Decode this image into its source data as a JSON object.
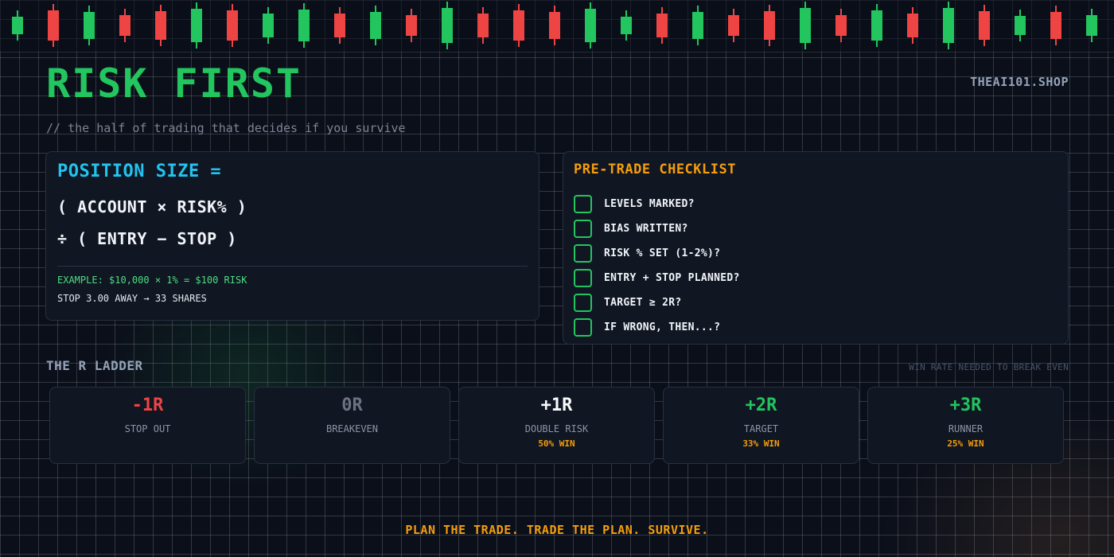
{
  "header": {
    "title": "RISK FIRST",
    "brand": "THEAI101.SHOP",
    "subtitle": "// the half of trading that decides if you survive"
  },
  "formula": {
    "title": "POSITION SIZE =",
    "line1": "( ACCOUNT × RISK% )",
    "line2": "÷ ( ENTRY − STOP )",
    "example": "EXAMPLE: $10,000 × 1% = $100 RISK",
    "shares": "STOP 3.00 AWAY → 33 SHARES"
  },
  "checklist": {
    "title": "PRE-TRADE CHECKLIST",
    "items": [
      {
        "label": "LEVELS MARKED?"
      },
      {
        "label": "BIAS WRITTEN?"
      },
      {
        "label": "RISK % SET (1-2%)?"
      },
      {
        "label": "ENTRY + STOP PLANNED?"
      },
      {
        "label": "TARGET ≥ 2R?"
      },
      {
        "label": "IF WRONG, THEN...?"
      }
    ]
  },
  "ladder": {
    "title": "THE R LADDER",
    "note": "WIN RATE NEEDED TO BREAK EVEN",
    "tiles": [
      {
        "value": "-1R",
        "label": "STOP OUT",
        "win": "",
        "color": "#ef4444"
      },
      {
        "value": "0R",
        "label": "BREAKEVEN",
        "win": "",
        "color": "#6b7280"
      },
      {
        "value": "+1R",
        "label": "DOUBLE RISK",
        "win": "50% WIN",
        "color": "#f8fafc"
      },
      {
        "value": "+2R",
        "label": "TARGET",
        "win": "33% WIN",
        "color": "#22c55e"
      },
      {
        "value": "+3R",
        "label": "RUNNER",
        "win": "25% WIN",
        "color": "#22c55e"
      }
    ]
  },
  "footer": {
    "text": "PLAN THE TRADE. TRADE THE PLAN. SURVIVE."
  },
  "colors": {
    "accent_green": "#22c55e",
    "accent_red": "#ef4444",
    "accent_cyan": "#22c3ee",
    "accent_amber": "#f59e0b",
    "background": "#0b0f1a"
  },
  "decor": {
    "candle_colors": [
      "green",
      "red",
      "green",
      "red",
      "red",
      "green",
      "red",
      "green",
      "green",
      "red",
      "green",
      "red",
      "green",
      "red",
      "red",
      "red",
      "green",
      "green",
      "red",
      "green",
      "red",
      "red",
      "green",
      "red",
      "green",
      "red",
      "green",
      "red",
      "green",
      "red",
      "green",
      "red",
      "green",
      "green",
      "red",
      "green",
      "red",
      "green",
      "red",
      "green"
    ]
  }
}
